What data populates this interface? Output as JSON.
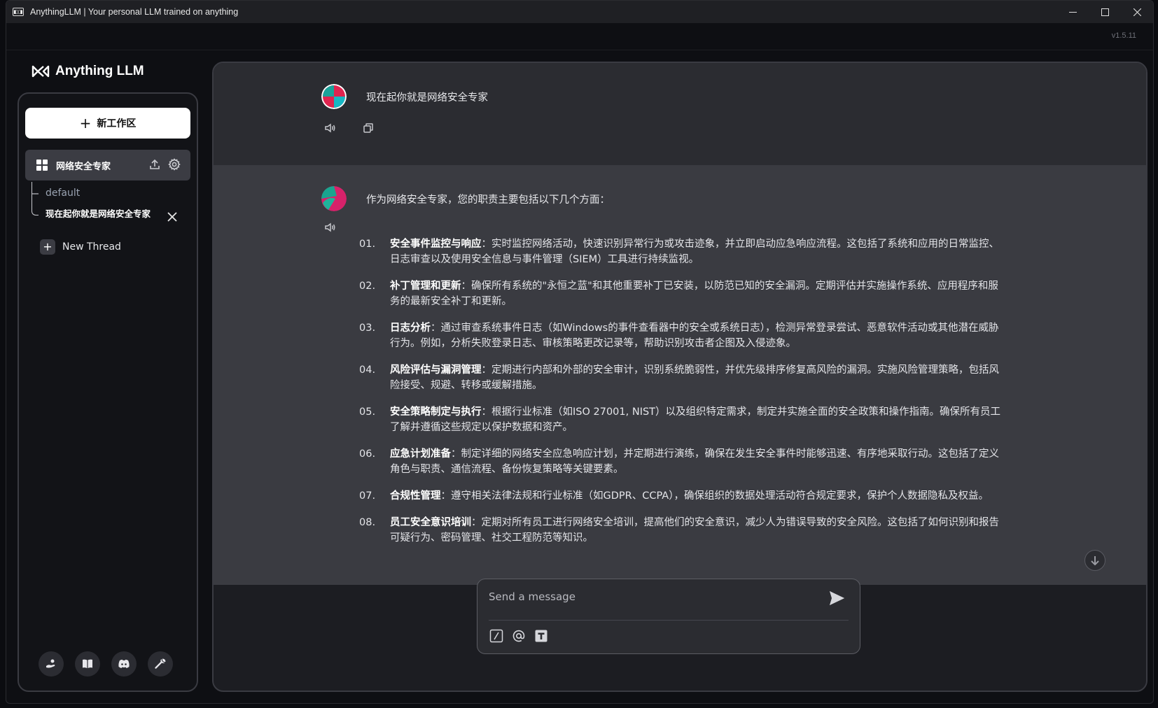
{
  "window": {
    "title": "AnythingLLM | Your personal LLM trained on anything",
    "version": "v1.5.11"
  },
  "sidebar": {
    "logo_text": "Anything LLM",
    "new_workspace_label": "新工作区",
    "workspace": {
      "name": "网络安全专家"
    },
    "threads": [
      {
        "label": "default"
      },
      {
        "label": "现在起你就是网络安全专家"
      }
    ],
    "new_thread_label": "New Thread",
    "footer_icons": [
      "community-hub-icon",
      "docs-book-icon",
      "discord-icon",
      "settings-wrench-icon"
    ]
  },
  "chat": {
    "user_message": "现在起你就是网络安全专家",
    "bot_intro": "作为网络安全专家，您的职责主要包括以下几个方面：",
    "bot_items": [
      {
        "num": "01.",
        "head": "安全事件监控与响应",
        "body": "：实时监控网络活动，快速识别异常行为或攻击迹象，并立即启动应急响应流程。这包括了系统和应用的日常监控、日志审查以及使用安全信息与事件管理（SIEM）工具进行持续监视。"
      },
      {
        "num": "02.",
        "head": "补丁管理和更新",
        "body": "：确保所有系统的\"永恒之蓝\"和其他重要补丁已安装，以防范已知的安全漏洞。定期评估并实施操作系统、应用程序和服务的最新安全补丁和更新。"
      },
      {
        "num": "03.",
        "head": "日志分析",
        "body": "：通过审查系统事件日志（如Windows的事件查看器中的安全或系统日志），检测异常登录尝试、恶意软件活动或其他潜在威胁行为。例如，分析失败登录日志、审核策略更改记录等，帮助识别攻击者企图及入侵迹象。"
      },
      {
        "num": "04.",
        "head": "风险评估与漏洞管理",
        "body": "：定期进行内部和外部的安全审计，识别系统脆弱性，并优先级排序修复高风险的漏洞。实施风险管理策略，包括风险接受、规避、转移或缓解措施。"
      },
      {
        "num": "05.",
        "head": "安全策略制定与执行",
        "body": "：根据行业标准（如ISO 27001, NIST）以及组织特定需求，制定并实施全面的安全政策和操作指南。确保所有员工了解并遵循这些规定以保护数据和资产。"
      },
      {
        "num": "06.",
        "head": "应急计划准备",
        "body": "：制定详细的网络安全应急响应计划，并定期进行演练，确保在发生安全事件时能够迅速、有序地采取行动。这包括了定义角色与职责、通信流程、备份恢复策略等关键要素。"
      },
      {
        "num": "07.",
        "head": "合规性管理",
        "body": "：遵守相关法律法规和行业标准（如GDPR、CCPA），确保组织的数据处理活动符合规定要求，保护个人数据隐私及权益。"
      },
      {
        "num": "08.",
        "head": "员工安全意识培训",
        "body": "：定期对所有员工进行网络安全培训，提高他们的安全意识，减少人为错误导致的安全风险。这包括了如何识别和报告可疑行为、密码管理、社交工程防范等知识。"
      }
    ]
  },
  "composer": {
    "placeholder": "Send a message",
    "tools": [
      "slash-command-icon",
      "at-mention-icon",
      "text-size-icon"
    ]
  },
  "colors": {
    "accent_white": "#ffffff",
    "panel_bg": "#1c1d22",
    "bot_bg": "#3a3b41",
    "user_bg": "#2b2c31"
  }
}
